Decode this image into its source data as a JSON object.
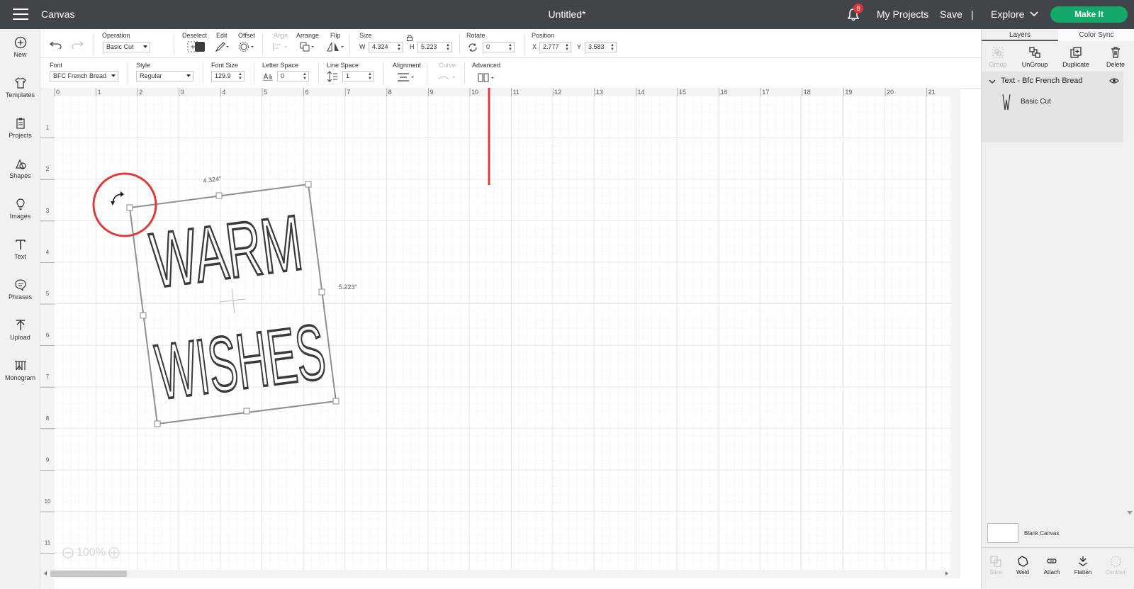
{
  "topbar": {
    "app_title": "Canvas",
    "doc_title": "Untitled*",
    "notification_count": "8",
    "my_projects": "My Projects",
    "save": "Save",
    "separator": "|",
    "explore": "Explore",
    "make_it": "Make It"
  },
  "leftrail": {
    "items": [
      {
        "label": "New",
        "icon": "plus-circle-icon"
      },
      {
        "label": "Templates",
        "icon": "shirt-icon"
      },
      {
        "label": "Projects",
        "icon": "clipboard-icon"
      },
      {
        "label": "Shapes",
        "icon": "shapes-icon"
      },
      {
        "label": "Images",
        "icon": "lightbulb-icon"
      },
      {
        "label": "Text",
        "icon": "text-icon"
      },
      {
        "label": "Phrases",
        "icon": "speech-bubble-icon"
      },
      {
        "label": "Upload",
        "icon": "upload-icon"
      },
      {
        "label": "Monogram",
        "icon": "monogram-icon"
      }
    ]
  },
  "toolbar1": {
    "operation_label": "Operation",
    "operation_value": "Basic Cut",
    "deselect": "Deselect",
    "edit": "Edit",
    "offset": "Offset",
    "align": "Align",
    "arrange": "Arrange",
    "flip": "Flip",
    "size_label": "Size",
    "w_label": "W",
    "w_value": "4.324",
    "h_label": "H",
    "h_value": "5.223",
    "rotate_label": "Rotate",
    "rotate_value": "0",
    "position_label": "Position",
    "x_label": "X",
    "x_value": "2.777",
    "y_label": "Y",
    "y_value": "3.583",
    "colors": {
      "swatch": "#3c3c3c"
    }
  },
  "toolbar2": {
    "font_label": "Font",
    "font_value": "BFC French Bread",
    "style_label": "Style",
    "style_value": "Regular",
    "font_size_label": "Font Size",
    "font_size_value": "129.9",
    "letter_space_label": "Letter Space",
    "letter_space_value": "0",
    "line_space_label": "Line Space",
    "line_space_value": "1",
    "alignment_label": "Alignment",
    "curve_label": "Curve",
    "advanced_label": "Advanced"
  },
  "canvas": {
    "ruler_top": [
      "0",
      "1",
      "2",
      "3",
      "4",
      "5",
      "6",
      "7",
      "8",
      "9",
      "10",
      "11",
      "12",
      "13",
      "14",
      "15",
      "16",
      "17",
      "18",
      "19",
      "20",
      "21"
    ],
    "ruler_left": [
      "1",
      "2",
      "3",
      "4",
      "5",
      "6",
      "7",
      "8",
      "9",
      "10",
      "11"
    ],
    "text_line1": "WARM",
    "text_line2": "WISHES",
    "width_readout": "4.324\"",
    "height_readout": "5.223\"",
    "zoom": "100%",
    "colors": {
      "annotation": "#e03b3b",
      "text": "#3a3a3a"
    }
  },
  "rightpanel": {
    "tab_layers": "Layers",
    "tab_color_sync": "Color Sync",
    "group": "Group",
    "ungroup": "UnGroup",
    "duplicate": "Duplicate",
    "delete": "Delete",
    "layer_title": "Text - Bfc French Bread",
    "layer_sub": "Basic Cut",
    "blank_canvas": "Blank Canvas",
    "slice": "Slice",
    "weld": "Weld",
    "attach": "Attach",
    "flatten": "Flatten",
    "contour": "Contour"
  }
}
